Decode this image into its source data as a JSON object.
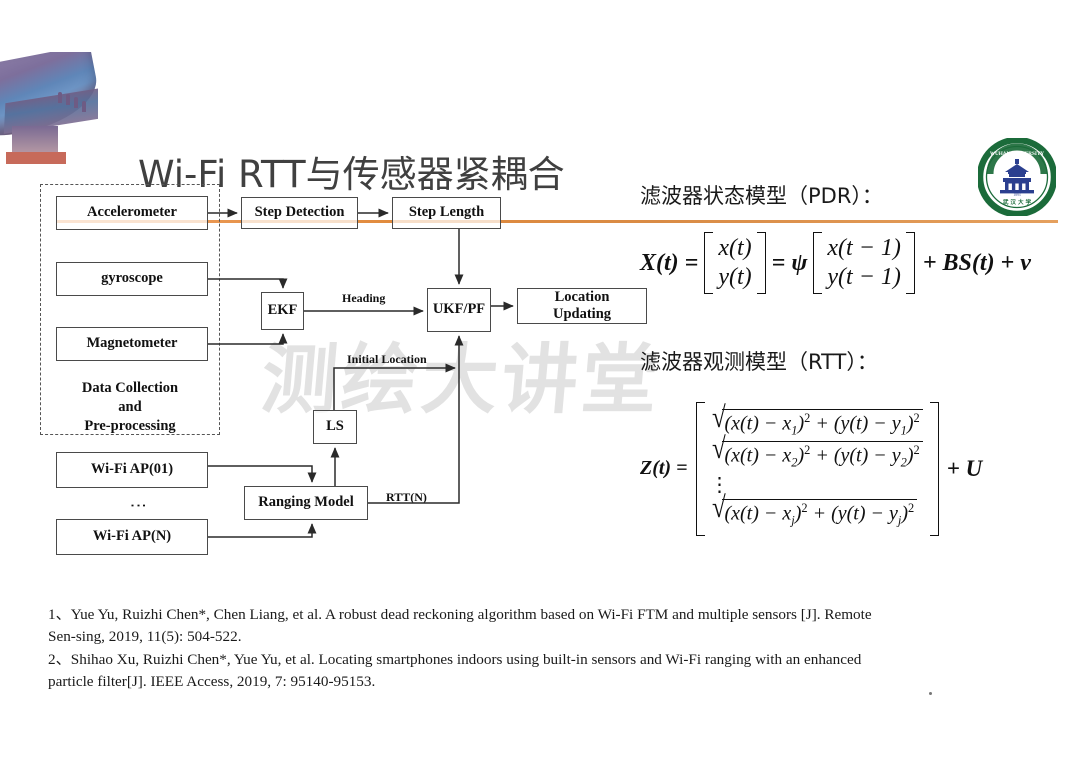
{
  "header": {
    "title": "Wi-Fi RTT与传感器紧耦合",
    "accent_color": "#e08a3c",
    "logo_name": "wuhan-university-seal",
    "logo_ring_color": "#1b6b3a",
    "logo_inner_color": "#2b3f8f",
    "decor_name": "chinese-roof-eave-photo"
  },
  "watermark": {
    "text": "测绘大讲堂",
    "color": "#e2e2e2"
  },
  "diagram": {
    "group": {
      "label_lines": [
        "Data Collection",
        "and",
        "Pre-processing"
      ]
    },
    "boxes": [
      {
        "id": "accelerometer",
        "label": "Accelerometer"
      },
      {
        "id": "gyroscope",
        "label": "gyroscope"
      },
      {
        "id": "magnetometer",
        "label": "Magnetometer"
      },
      {
        "id": "step-detection",
        "label": "Step Detection"
      },
      {
        "id": "step-length",
        "label": "Step Length"
      },
      {
        "id": "ekf",
        "label": "EKF"
      },
      {
        "id": "ukf-pf",
        "label": "UKF/PF"
      },
      {
        "id": "location-updating",
        "label": "Location\nUpdating"
      },
      {
        "id": "location-updating-l1",
        "label": "Location"
      },
      {
        "id": "location-updating-l2",
        "label": "Updating"
      },
      {
        "id": "ls",
        "label": "LS"
      },
      {
        "id": "wifi-ap-01",
        "label": "Wi-Fi AP(01)"
      },
      {
        "id": "wifi-ap-n",
        "label": "Wi-Fi AP(N)"
      },
      {
        "id": "ranging-model",
        "label": "Ranging Model"
      }
    ],
    "edge_labels": [
      {
        "id": "heading",
        "label": "Heading"
      },
      {
        "id": "initial-location",
        "label": "Initial Location"
      },
      {
        "id": "rtt-n",
        "label": "RTT(N)"
      }
    ],
    "ap_ellipsis": "⋮"
  },
  "formulas": {
    "state_model": {
      "heading": "滤波器状态模型（PDR）：",
      "lhs": "X(t) =",
      "vec_left": [
        "x(t)",
        "y(t)"
      ],
      "mid": "= ψ",
      "vec_right": [
        "x(t − 1)",
        "y(t − 1)"
      ],
      "tail": "+ BS(t) + v"
    },
    "observation_model": {
      "heading": "滤波器观测模型（RTT）：",
      "lhs": "Z(t) =",
      "rows": [
        {
          "x_sub": "1",
          "y_sub": "1"
        },
        {
          "x_sub": "2",
          "y_sub": "2"
        },
        {
          "x_sub": "j",
          "y_sub": "j"
        }
      ],
      "row_ellipsis": "⋮",
      "tail": "+ U",
      "row_template": "√( (x(t) − x_i)² + (y(t) − y_i)² )"
    }
  },
  "references": {
    "items": [
      "1、Yue Yu, Ruizhi Chen*, Chen Liang, et al. A robust dead reckoning algorithm based on Wi-Fi FTM and multiple sensors [J]. Remote Sen-sing, 2019, 11(5): 504-522.",
      "2、Shihao Xu, Ruizhi Chen*, Yue Yu, et al. Locating smartphones indoors using built-in sensors and Wi-Fi ranging with an enhanced particle filter[J]. IEEE Access, 2019, 7: 95140-95153."
    ]
  }
}
